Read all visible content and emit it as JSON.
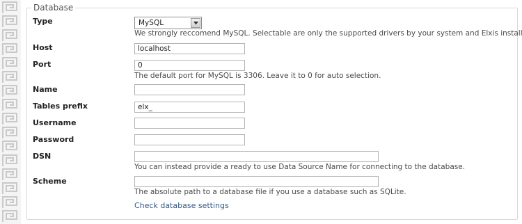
{
  "fieldset": {
    "legend": "Database"
  },
  "type": {
    "label": "Type",
    "selected": "MySQL",
    "help": "We strongly reccomend MySQL. Selectable are only the supported drivers by your system and Elxis installer."
  },
  "host": {
    "label": "Host",
    "value": "localhost"
  },
  "port": {
    "label": "Port",
    "value": "0",
    "help": "The default port for MySQL is 3306. Leave it to 0 for auto selection."
  },
  "name": {
    "label": "Name",
    "value": ""
  },
  "prefix": {
    "label": "Tables prefix",
    "value": "elx_"
  },
  "username": {
    "label": "Username",
    "value": ""
  },
  "password": {
    "label": "Password",
    "value": ""
  },
  "dsn": {
    "label": "DSN",
    "value": "",
    "help": "You can instead provide a ready to use Data Source Name for connecting to the database."
  },
  "scheme": {
    "label": "Scheme",
    "value": "",
    "help": "The absolute path to a database file if you use a database such as SQLite."
  },
  "check_link": "Check database settings",
  "colors": {
    "link": "#335a87",
    "border_pattern": "#c9c9c9"
  },
  "icons": {
    "select_arrow": "chevron-down-icon"
  }
}
